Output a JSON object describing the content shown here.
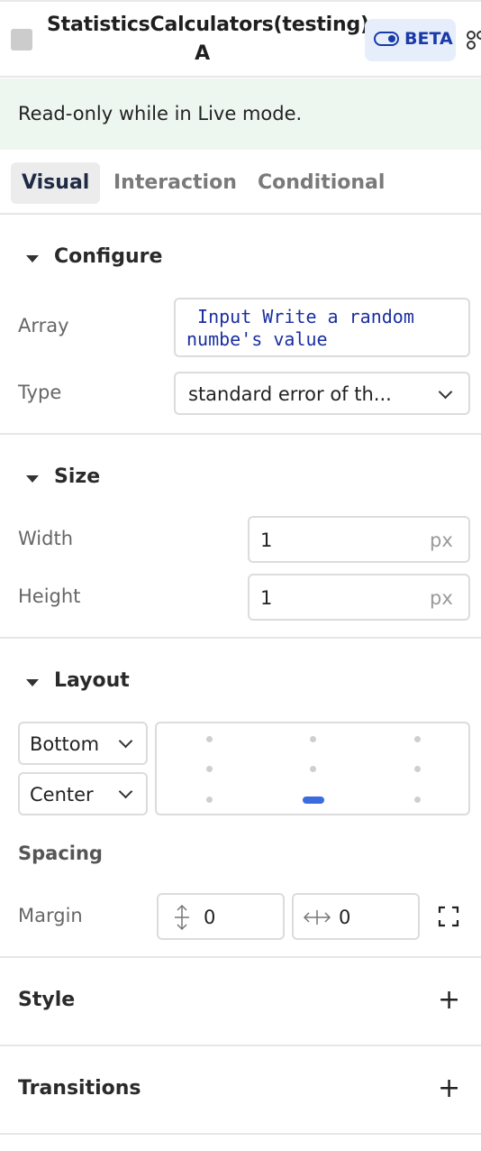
{
  "header": {
    "title": "StatisticsCalculators(testing) A",
    "badge": "BETA"
  },
  "notice": "Read-only while in Live mode.",
  "tabs": [
    "Visual",
    "Interaction",
    "Conditional"
  ],
  "configure": {
    "title": "Configure",
    "array_label": "Array",
    "array_value": " Input Write a random numbe's value",
    "type_label": "Type",
    "type_value": "standard error of th..."
  },
  "size": {
    "title": "Size",
    "width_label": "Width",
    "width_value": "1",
    "height_label": "Height",
    "height_value": "1",
    "unit": "px"
  },
  "layout": {
    "title": "Layout",
    "vertical_align": "Bottom",
    "horizontal_align": "Center",
    "selected_position": "bottom-center"
  },
  "spacing": {
    "title": "Spacing",
    "margin_label": "Margin",
    "margin_vertical": "0",
    "margin_horizontal": "0"
  },
  "style": {
    "title": "Style"
  },
  "transitions": {
    "title": "Transitions"
  },
  "colors": {
    "accent": "#3b6be0",
    "notice_bg": "#eef6f0",
    "badge_bg": "#e6eefc"
  },
  "icons": [
    "toggle-icon",
    "more-icon",
    "caret-down-icon",
    "chevron-down-icon",
    "vertical-margin-icon",
    "horizontal-margin-icon",
    "expand-icon",
    "plus-icon"
  ]
}
